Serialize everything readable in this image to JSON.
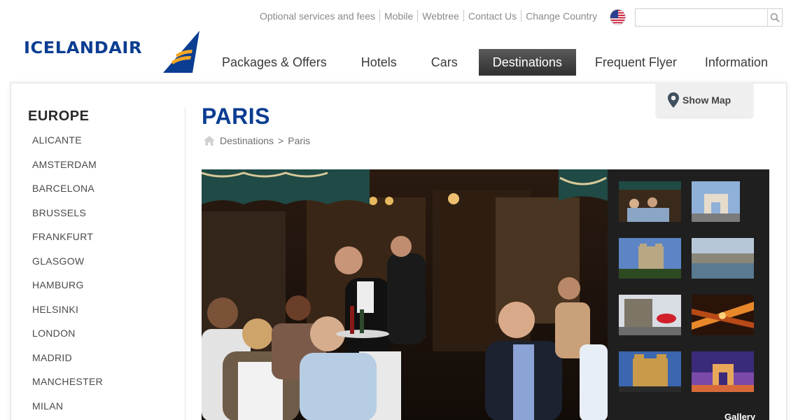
{
  "utility_links": [
    "Optional services and fees",
    "Mobile",
    "Webtree",
    "Contact Us",
    "Change Country"
  ],
  "country_flag": "us-flag-icon",
  "search": {
    "value": "",
    "placeholder": ""
  },
  "logo": {
    "text": "ICELANDAIR"
  },
  "nav": {
    "items": [
      "Packages & Offers",
      "Hotels",
      "Cars",
      "Destinations",
      "Frequent Flyer",
      "Information"
    ],
    "active": "Destinations"
  },
  "map_button": {
    "label": "Show Map",
    "icon": "map-pin-icon"
  },
  "sidebar": {
    "heading": "EUROPE",
    "items": [
      "ALICANTE",
      "AMSTERDAM",
      "BARCELONA",
      "BRUSSELS",
      "FRANKFURT",
      "GLASGOW",
      "HAMBURG",
      "HELSINKI",
      "LONDON",
      "MADRID",
      "MANCHESTER",
      "MILAN"
    ]
  },
  "page": {
    "title": "PARIS",
    "breadcrumb": {
      "parent": "Destinations",
      "separator": ">",
      "current": "Paris"
    }
  },
  "gallery": {
    "label": "Gallery"
  },
  "colors": {
    "brand_blue": "#0b3d91",
    "logo_orange": "#f5a623",
    "active_nav": "#3a3a3a",
    "gallery_bg": "#1f1f1f"
  }
}
